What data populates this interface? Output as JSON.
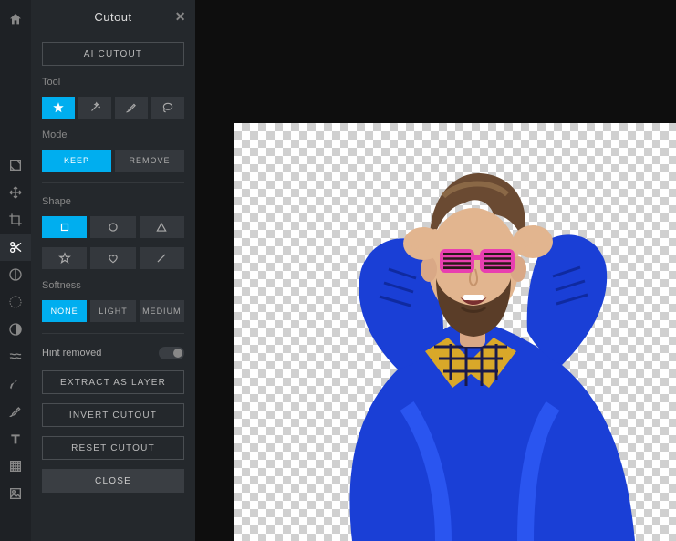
{
  "panel": {
    "title": "Cutout",
    "ai_cutout": "AI CUTOUT",
    "tool_label": "Tool",
    "mode_label": "Mode",
    "mode_keep": "KEEP",
    "mode_remove": "REMOVE",
    "shape_label": "Shape",
    "softness_label": "Softness",
    "softness_none": "NONE",
    "softness_light": "LIGHT",
    "softness_medium": "MEDIUM",
    "hint_removed": "Hint removed",
    "extract_layer": "EXTRACT AS LAYER",
    "invert": "INVERT CUTOUT",
    "reset": "RESET CUTOUT",
    "close": "CLOSE"
  },
  "toolbar": {
    "home": "home-icon",
    "items": [
      "image",
      "move",
      "crop",
      "cutout",
      "adjust",
      "liquify",
      "retouch",
      "focus",
      "painting",
      "brush",
      "text",
      "elements",
      "layer"
    ]
  },
  "canvas": {
    "description": "Man with beard in blue sweater holding pink shutter glasses, yellow plaid collar, background removed (transparent checkerboard)"
  }
}
